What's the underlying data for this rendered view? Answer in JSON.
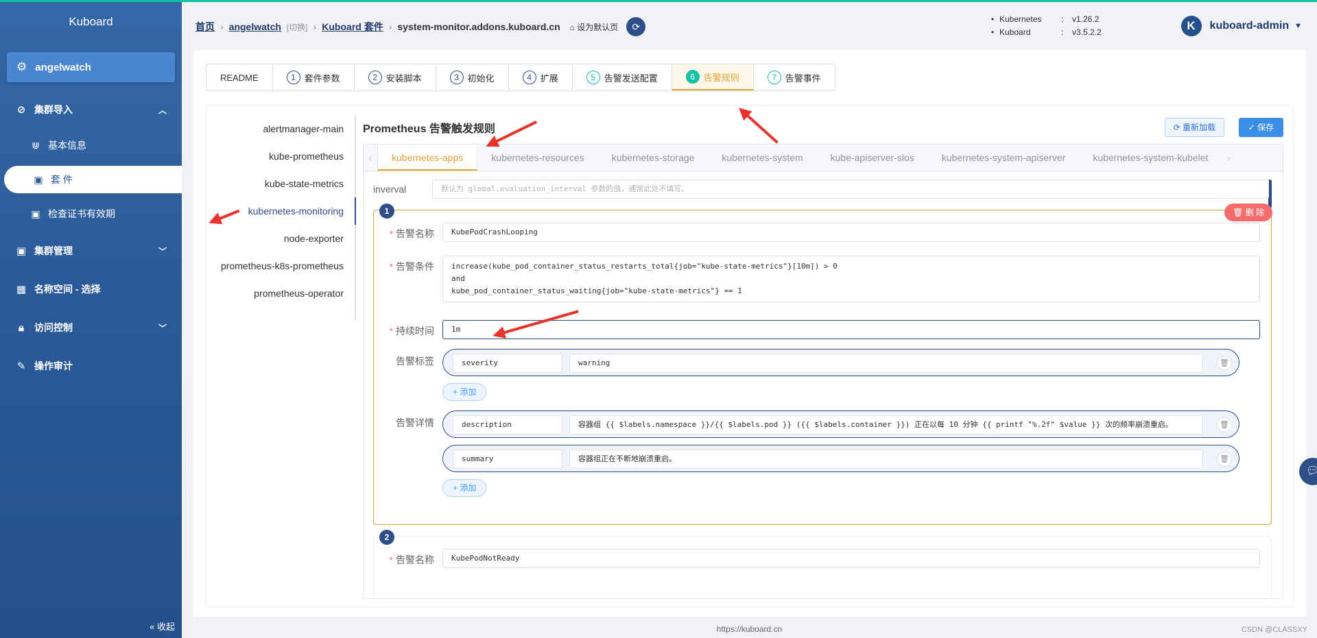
{
  "sidebar": {
    "brand": "Kuboard",
    "cluster": "angelwatch",
    "menu": {
      "import": "集群导入",
      "basic_info": "基本信息",
      "suite": "套 件",
      "cert_check": "检查证书有效期",
      "manage": "集群管理",
      "namespace": "名称空间 - 选择",
      "access": "访问控制",
      "audit": "操作审计"
    },
    "collapse": "« 收起"
  },
  "header": {
    "breadcrumb": {
      "home": "首页",
      "cluster": "angelwatch",
      "switch": "[切换]",
      "suites": "Kuboard 套件",
      "current": "system-monitor.addons.kuboard.cn",
      "set_default": "设为默认页"
    },
    "versions": [
      {
        "name": "Kubernetes",
        "value": "v1.26.2"
      },
      {
        "name": "Kuboard",
        "value": "v3.5.2.2"
      }
    ],
    "user": {
      "avatar_letter": "K",
      "name": "kuboard-admin"
    }
  },
  "steps": [
    {
      "num": "",
      "label": "README"
    },
    {
      "num": "1",
      "label": "套件参数"
    },
    {
      "num": "2",
      "label": "安装脚本"
    },
    {
      "num": "3",
      "label": "初始化"
    },
    {
      "num": "4",
      "label": "扩展"
    },
    {
      "num": "5",
      "label": "告警发送配置"
    },
    {
      "num": "6",
      "label": "告警规则"
    },
    {
      "num": "7",
      "label": "告警事件"
    }
  ],
  "rules_list": [
    "alertmanager-main",
    "kube-prometheus",
    "kube-state-metrics",
    "kubernetes-monitoring",
    "node-exporter",
    "prometheus-k8s-prometheus",
    "prometheus-operator"
  ],
  "content": {
    "title": "Prometheus 告警触发规则",
    "reload": "重新加载",
    "save": "保存",
    "group_tabs": [
      "kubernetes-apps",
      "kubernetes-resources",
      "kubernetes-storage",
      "kubernetes-system",
      "kube-apiserver-slos",
      "kubernetes-system-apiserver",
      "kubernetes-system-kubelet"
    ],
    "interval_label": "inverval",
    "interval_placeholder": "默认为 global.evaluation_interval 参数的值，通常此处不填写。",
    "rule1": {
      "badge": "1",
      "delete": "删 除",
      "name_label": "告警名称",
      "name": "KubePodCrashLooping",
      "expr_label": "告警条件",
      "expr": "increase(kube_pod_container_status_restarts_total{job=\"kube-state-metrics\"}[10m]) > 0\nand\nkube_pod_container_status_waiting{job=\"kube-state-metrics\"} == 1",
      "for_label": "持续时间",
      "for": "1m",
      "labels_label": "告警标签",
      "labels": [
        {
          "key": "severity",
          "value": "warning"
        }
      ],
      "add": "+ 添加",
      "annotations_label": "告警详情",
      "annotations": [
        {
          "key": "description",
          "value": "容器组 {{ $labels.namespace }}/{{ $labels.pod }} ({{ $labels.container }}) 正在以每 10 分钟 {{ printf \"%.2f\" $value }} 次的频率崩溃重启。"
        },
        {
          "key": "summary",
          "value": "容器组正在不断地崩溃重启。"
        }
      ]
    },
    "rule2": {
      "badge": "2",
      "name_label": "告警名称",
      "name": "KubePodNotReady"
    }
  },
  "footer": "https://kuboard.cn",
  "watermark": "CSDN @CLASSXY"
}
